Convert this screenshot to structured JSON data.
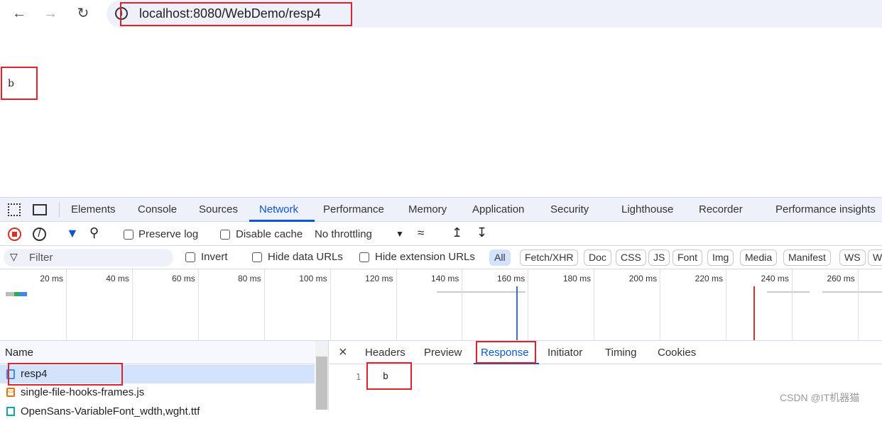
{
  "browser": {
    "url": "localhost:8080/WebDemo/resp4",
    "back_icon": "arrow-left",
    "forward_icon": "arrow-right",
    "reload_icon": "reload",
    "info_icon": "info-circle"
  },
  "page": {
    "body_text": "b"
  },
  "devtools": {
    "tabs": [
      "Elements",
      "Console",
      "Sources",
      "Network",
      "Performance",
      "Memory",
      "Application",
      "Security",
      "Lighthouse",
      "Recorder",
      "Performance insights"
    ],
    "active_tab": "Network",
    "toolbar": {
      "preserve_log": "Preserve log",
      "disable_cache": "Disable cache",
      "throttling": "No throttling"
    },
    "filter": {
      "placeholder": "Filter",
      "invert": "Invert",
      "hide_data_urls": "Hide data URLs",
      "hide_extension_urls": "Hide extension URLs",
      "types": [
        "All",
        "Fetch/XHR",
        "Doc",
        "CSS",
        "JS",
        "Font",
        "Img",
        "Media",
        "Manifest",
        "WS",
        "W"
      ],
      "selected_type": "All"
    },
    "timeline_ticks": [
      "20 ms",
      "40 ms",
      "60 ms",
      "80 ms",
      "100 ms",
      "120 ms",
      "140 ms",
      "160 ms",
      "180 ms",
      "200 ms",
      "220 ms",
      "240 ms",
      "260 ms"
    ],
    "requests": {
      "header": "Name",
      "rows": [
        "resp4",
        "single-file-hooks-frames.js",
        "OpenSans-VariableFont_wdth,wght.ttf"
      ]
    },
    "detail": {
      "tabs": [
        "Headers",
        "Preview",
        "Response",
        "Initiator",
        "Timing",
        "Cookies"
      ],
      "active_tab": "Response",
      "line_number": "1",
      "response_body": "b"
    }
  },
  "watermark": "CSDN @IT机器猫",
  "colors": {
    "accent": "#0b57d0",
    "highlight": "#e0202a",
    "selected_row": "#d3e3fd"
  }
}
